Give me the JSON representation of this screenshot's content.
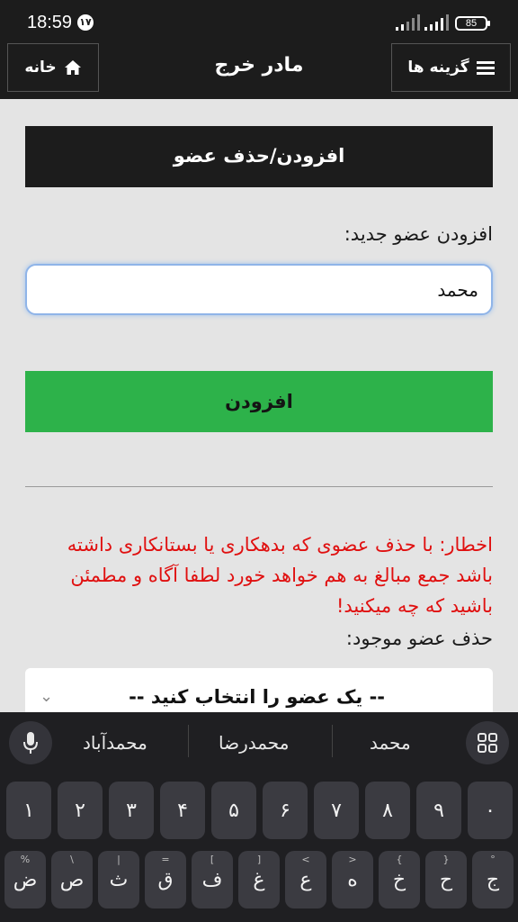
{
  "status_bar": {
    "time": "18:59",
    "notification_badge": "۱۷",
    "battery": "85"
  },
  "header": {
    "home_label": "خانه",
    "title": "مادر خرج",
    "menu_label": "گزینه ها"
  },
  "main": {
    "section_title": "افزودن/حذف عضو",
    "add_label": "افزودن عضو جدید:",
    "add_input_value": "محمد",
    "add_button": "افزودن",
    "warning": "اخطار: با حذف عضوی که بدهکاری یا بستانکاری داشته باشد جمع مبالغ به هم خواهد خورد لطفا آگاه و مطمئن باشید که چه میکنید!",
    "remove_label": "حذف عضو موجود:",
    "select_value": "-- یک عضو را انتخاب کنید --"
  },
  "keyboard": {
    "suggestions": [
      "محمد",
      "محمدرضا",
      "محمدآباد"
    ],
    "row_numbers": [
      "۱",
      "۲",
      "۳",
      "۴",
      "۵",
      "۶",
      "۷",
      "۸",
      "۹",
      "۰"
    ],
    "row_letters": [
      {
        "key": "ض",
        "hint": "%"
      },
      {
        "key": "ص",
        "hint": "\\"
      },
      {
        "key": "ث",
        "hint": "|"
      },
      {
        "key": "ق",
        "hint": "="
      },
      {
        "key": "ف",
        "hint": "["
      },
      {
        "key": "غ",
        "hint": "]"
      },
      {
        "key": "ع",
        "hint": "<"
      },
      {
        "key": "ه",
        "hint": ">"
      },
      {
        "key": "خ",
        "hint": "{"
      },
      {
        "key": "ح",
        "hint": "}"
      },
      {
        "key": "ج",
        "hint": "°"
      }
    ]
  }
}
